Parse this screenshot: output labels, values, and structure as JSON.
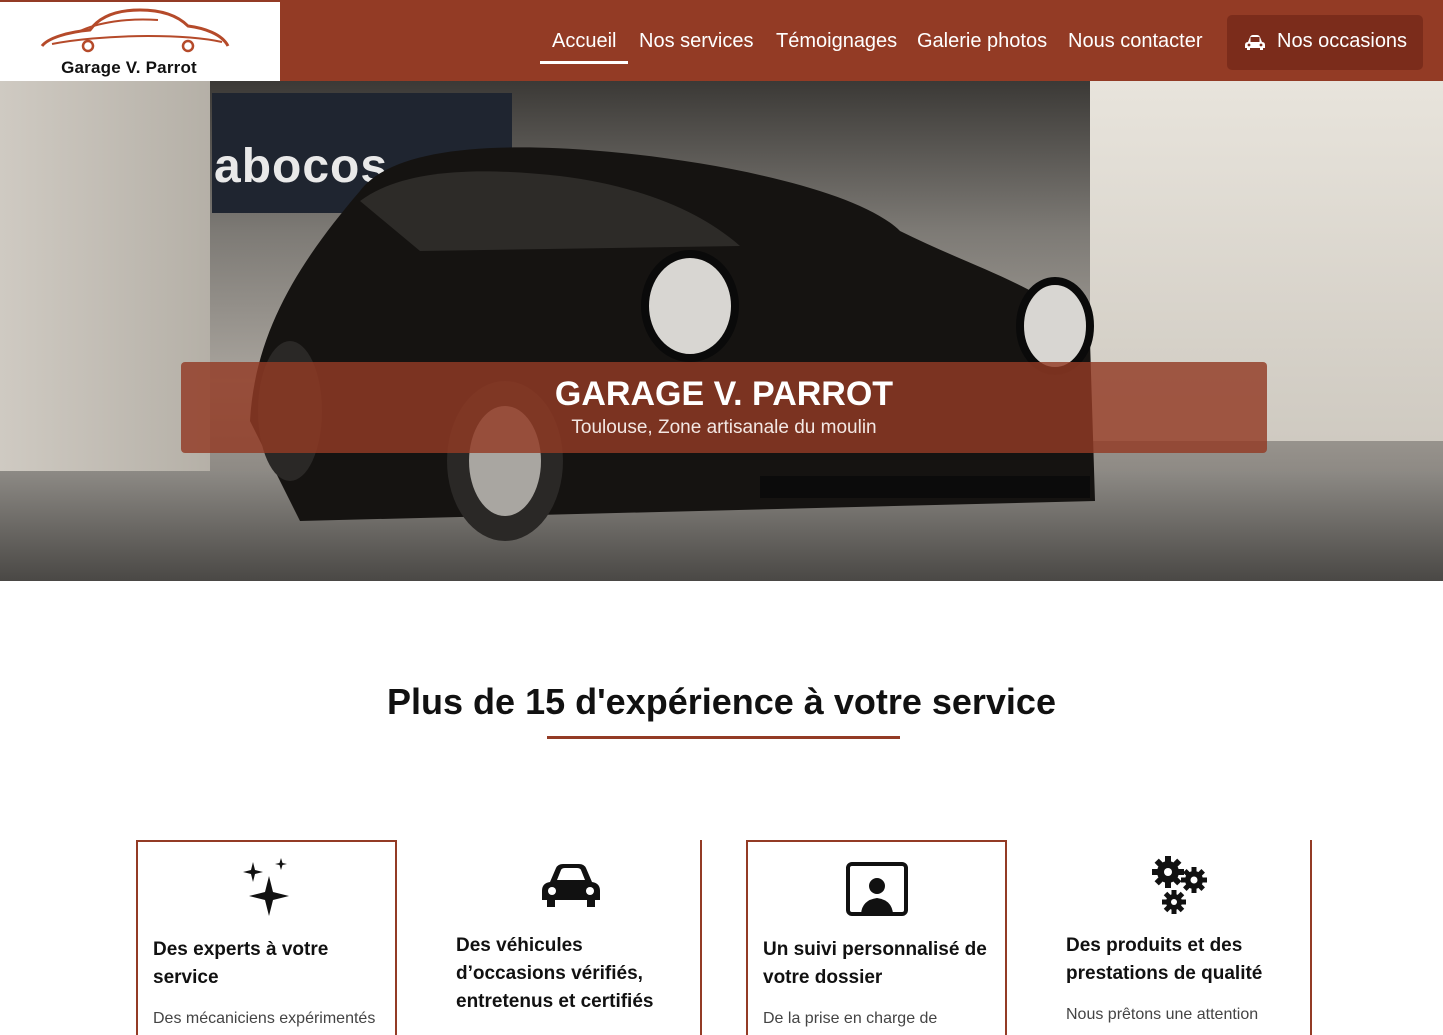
{
  "brand": {
    "name": "Garage V. Parrot",
    "color": "#933b25"
  },
  "nav": {
    "items": [
      {
        "label": "Accueil",
        "active": true
      },
      {
        "label": "Nos services"
      },
      {
        "label": "Témoignages"
      },
      {
        "label": "Galerie photos"
      },
      {
        "label": "Nous contacter"
      }
    ],
    "cta": {
      "label": "Nos occasions",
      "icon": "car-icon"
    }
  },
  "hero": {
    "sign": "abocos",
    "title": "GARAGE V. PARROT",
    "subtitle": "Toulouse, Zone artisanale du moulin"
  },
  "section": {
    "title": "Plus de 15 d'expérience à votre service"
  },
  "cards": [
    {
      "icon": "sparkles-icon",
      "title": "Des experts à votre service",
      "text": "Des mécaniciens expérimentés"
    },
    {
      "icon": "car-icon",
      "title": "Des véhicules d’occasions vérifiés, entretenus et certifiés",
      "text": ""
    },
    {
      "icon": "person-monitor-icon",
      "title": "Un suivi personnalisé de votre dossier",
      "text": "De la prise en charge de"
    },
    {
      "icon": "gears-icon",
      "title": "Des produits et des prestations de qualité",
      "text": "Nous prêtons une attention"
    }
  ]
}
